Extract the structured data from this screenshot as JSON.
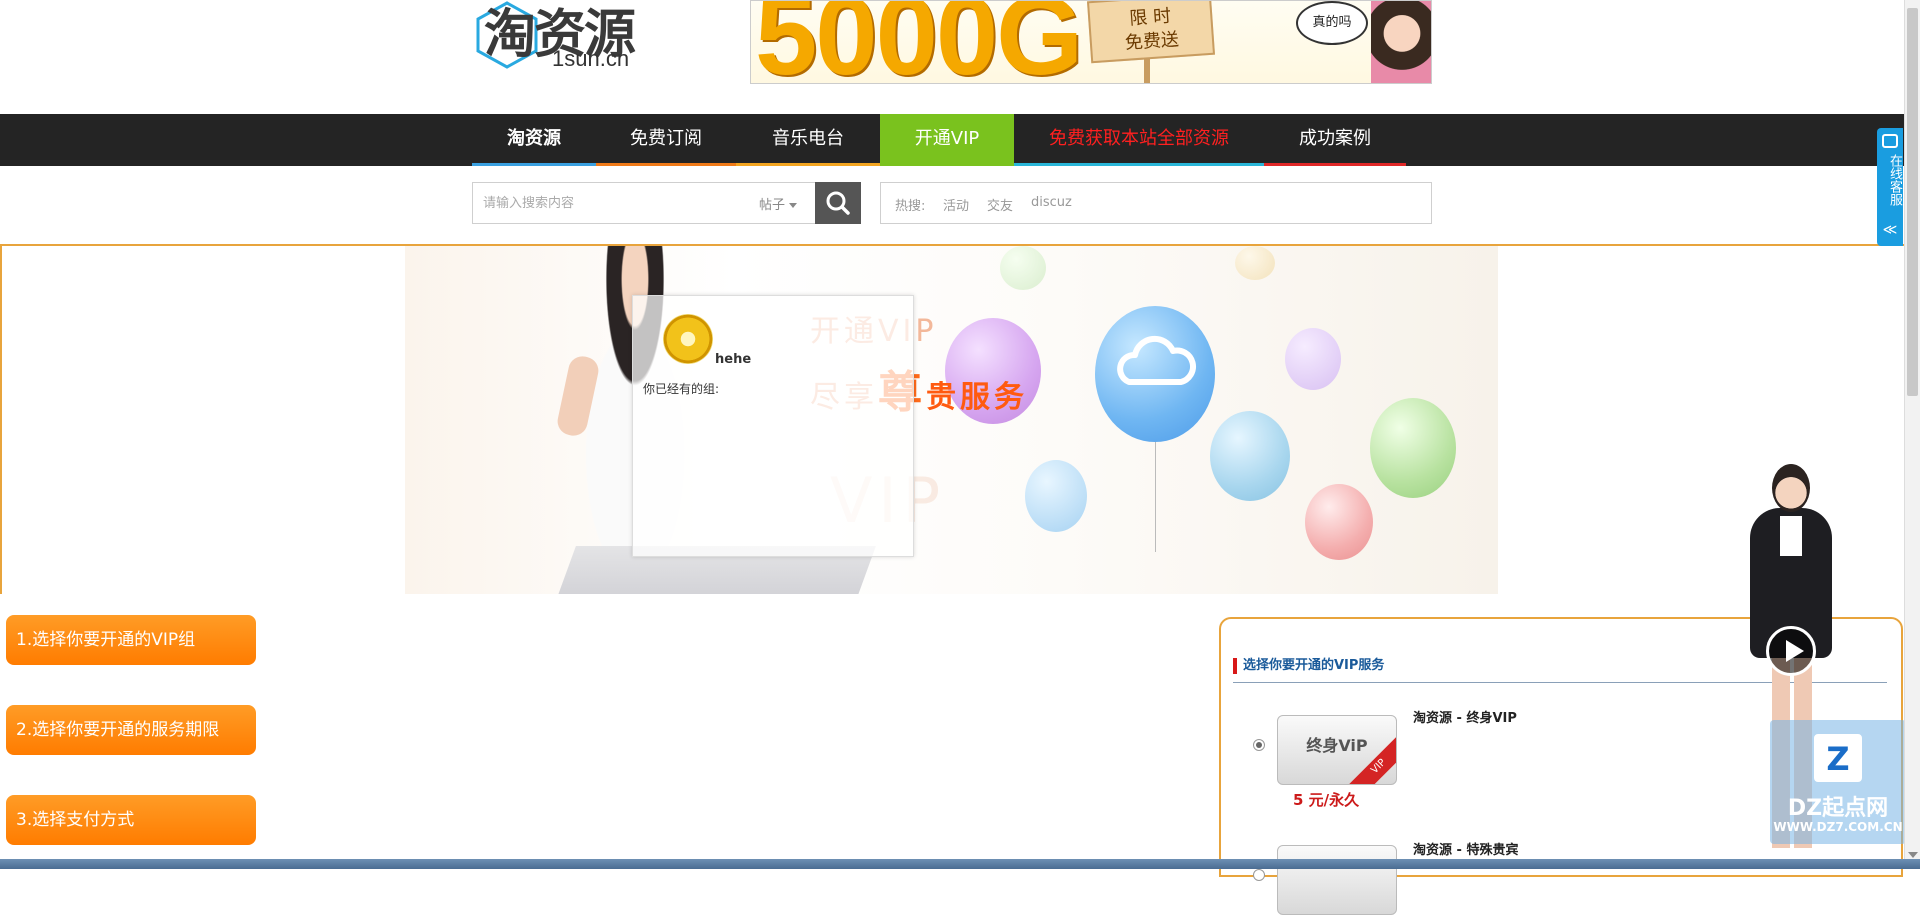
{
  "header": {
    "logo": {
      "main_text": "淘资源",
      "sub_text": "1sun.cn"
    },
    "banner": {
      "number": "5000G",
      "sign_line1": "限 时",
      "sign_line2": "免费送",
      "bubble": "真的吗"
    }
  },
  "nav": {
    "items": [
      {
        "label": "淘资源"
      },
      {
        "label": "免费订阅"
      },
      {
        "label": "音乐电台"
      },
      {
        "label": "开通VIP"
      },
      {
        "label": "免费获取本站全部资源"
      },
      {
        "label": "成功案例"
      }
    ]
  },
  "search": {
    "placeholder": "请输入搜索内容",
    "scope": "帖子",
    "hot_label": "热搜:",
    "hot_links": [
      "活动",
      "交友",
      "discuz"
    ]
  },
  "hero": {
    "line1": "开通VIP",
    "line2_prefix": "尽享",
    "line2_big": "尊",
    "line2_suffix": "贵服务",
    "ghost": "VIP",
    "user": {
      "name": "hehe",
      "group_label": "你已经有的组:"
    }
  },
  "steps": [
    "1.选择你要开通的VIP组",
    "2.选择你要开通的服务期限",
    "3.选择支付方式"
  ],
  "vip_panel": {
    "title": "选择你要开通的VIP服务",
    "options": [
      {
        "name": "淘资源 - 终身VIP",
        "card_label": "终身ViP",
        "ribbon": "VIP",
        "price": "5 元/永久",
        "selected": true
      },
      {
        "name": "淘资源 - 特殊贵宾",
        "selected": false
      }
    ]
  },
  "service": {
    "label": "在线客服",
    "collapse": "≪"
  },
  "watermark": {
    "mark": "Z",
    "name": "DZ起点网",
    "url": "WWW.DZ7.COM.CN"
  }
}
